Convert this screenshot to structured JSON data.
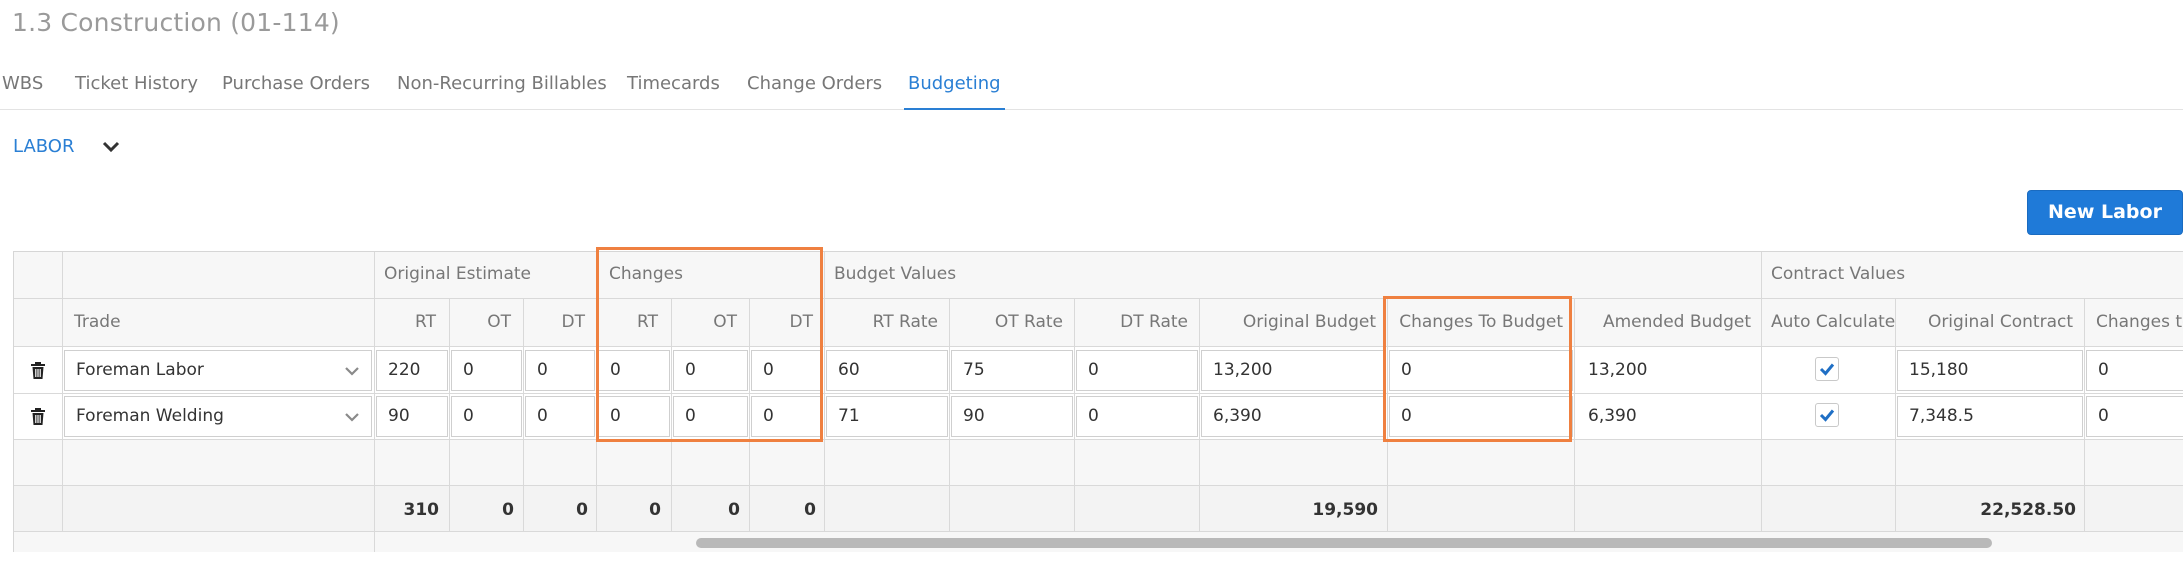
{
  "page": {
    "title": "1.3 Construction (01-114)"
  },
  "tabs": [
    {
      "label": "WBS"
    },
    {
      "label": "Ticket History"
    },
    {
      "label": "Purchase Orders"
    },
    {
      "label": "Non-Recurring Billables"
    },
    {
      "label": "Timecards"
    },
    {
      "label": "Change Orders"
    },
    {
      "label": "Budgeting",
      "active": true
    }
  ],
  "section": {
    "label": "LABOR",
    "collapse_icon": "chevron-down-icon"
  },
  "toolbar": {
    "new_label": "New Labor"
  },
  "colors": {
    "accent": "#2a7fd4",
    "button": "#1f7ad8",
    "highlight": "#ef8040"
  },
  "grid": {
    "groups": {
      "original_estimate": "Original Estimate",
      "changes": "Changes",
      "budget_values": "Budget Values",
      "contract_values": "Contract Values"
    },
    "headers": {
      "trade": "Trade",
      "oe_rt": "RT",
      "oe_ot": "OT",
      "oe_dt": "DT",
      "ch_rt": "RT",
      "ch_ot": "OT",
      "ch_dt": "DT",
      "rt_rate": "RT Rate",
      "ot_rate": "OT Rate",
      "dt_rate": "DT Rate",
      "original_budget": "Original Budget",
      "changes_to_budget": "Changes To Budget",
      "amended_budget": "Amended Budget",
      "auto_calculate": "Auto Calculate",
      "original_contract": "Original Contract",
      "changes_to_contract": "Changes to"
    },
    "rows": [
      {
        "trade": "Foreman Labor",
        "oe_rt": "220",
        "oe_ot": "0",
        "oe_dt": "0",
        "ch_rt": "0",
        "ch_ot": "0",
        "ch_dt": "0",
        "rt_rate": "60",
        "ot_rate": "75",
        "dt_rate": "0",
        "original_budget": "13,200",
        "changes_to_budget": "0",
        "amended_budget": "13,200",
        "auto_calculate": true,
        "original_contract": "15,180",
        "changes_to_contract": "0"
      },
      {
        "trade": "Foreman Welding",
        "oe_rt": "90",
        "oe_ot": "0",
        "oe_dt": "0",
        "ch_rt": "0",
        "ch_ot": "0",
        "ch_dt": "0",
        "rt_rate": "71",
        "ot_rate": "90",
        "dt_rate": "0",
        "original_budget": "6,390",
        "changes_to_budget": "0",
        "amended_budget": "6,390",
        "auto_calculate": true,
        "original_contract": "7,348.5",
        "changes_to_contract": "0"
      }
    ],
    "totals": {
      "oe_rt": "310",
      "oe_ot": "0",
      "oe_dt": "0",
      "ch_rt": "0",
      "ch_ot": "0",
      "ch_dt": "0",
      "original_budget": "19,590",
      "original_contract": "22,528.50"
    }
  }
}
